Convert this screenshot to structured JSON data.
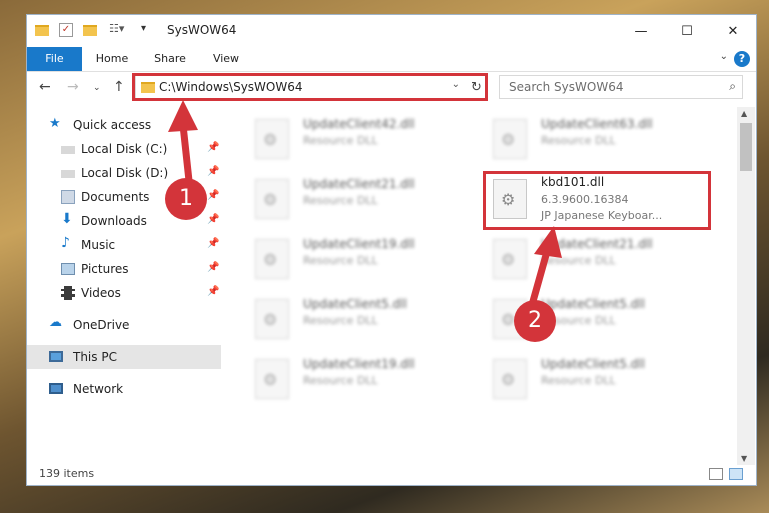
{
  "window": {
    "title": "SysWOW64",
    "controls": {
      "minimize": "—",
      "maximize": "☐",
      "close": "✕"
    }
  },
  "ribbon": {
    "tabs": [
      "File",
      "Home",
      "Share",
      "View"
    ],
    "help": "?"
  },
  "address": {
    "path": "C:\\Windows\\SysWOW64",
    "search_placeholder": "Search SysWOW64"
  },
  "sidebar": {
    "items": [
      {
        "label": "Quick access",
        "icon": "star-icon"
      },
      {
        "label": "Local Disk (C:)",
        "icon": "drive-icon"
      },
      {
        "label": "Local Disk (D:)",
        "icon": "drive-icon"
      },
      {
        "label": "Documents",
        "icon": "documents-icon"
      },
      {
        "label": "Downloads",
        "icon": "downloads-icon"
      },
      {
        "label": "Music",
        "icon": "music-icon"
      },
      {
        "label": "Pictures",
        "icon": "pictures-icon"
      },
      {
        "label": "Videos",
        "icon": "videos-icon"
      },
      {
        "label": "OneDrive",
        "icon": "onedrive-icon"
      },
      {
        "label": "This PC",
        "icon": "this-pc-icon"
      },
      {
        "label": "Network",
        "icon": "network-icon"
      }
    ]
  },
  "files": [
    {
      "name": "UpdateClient42.dll",
      "sub": "Resource DLL"
    },
    {
      "name": "UpdateClient63.dll",
      "sub": "Resource DLL"
    },
    {
      "name": "UpdateClient21.dll",
      "sub": "Resource DLL"
    },
    {
      "name": "kbd101.dll",
      "sub": "6.3.9600.16384",
      "desc": "JP Japanese Keyboar..."
    },
    {
      "name": "UpdateClient19.dll",
      "sub": "Resource DLL"
    },
    {
      "name": "UpdateClient21.dll",
      "sub": "Resource DLL"
    },
    {
      "name": "UpdateClient5.dll",
      "sub": "Resource DLL"
    },
    {
      "name": "UpdateClient5.dll",
      "sub": "Resource DLL"
    },
    {
      "name": "UpdateClient19.dll",
      "sub": "Resource DLL"
    },
    {
      "name": "UpdateClient5.dll",
      "sub": "Resource DLL"
    }
  ],
  "status": {
    "items_count": "139 items"
  },
  "annotations": {
    "step1": "1",
    "step2": "2"
  },
  "colors": {
    "highlight_red": "#d3343a",
    "file_tab_blue": "#1979ca"
  }
}
